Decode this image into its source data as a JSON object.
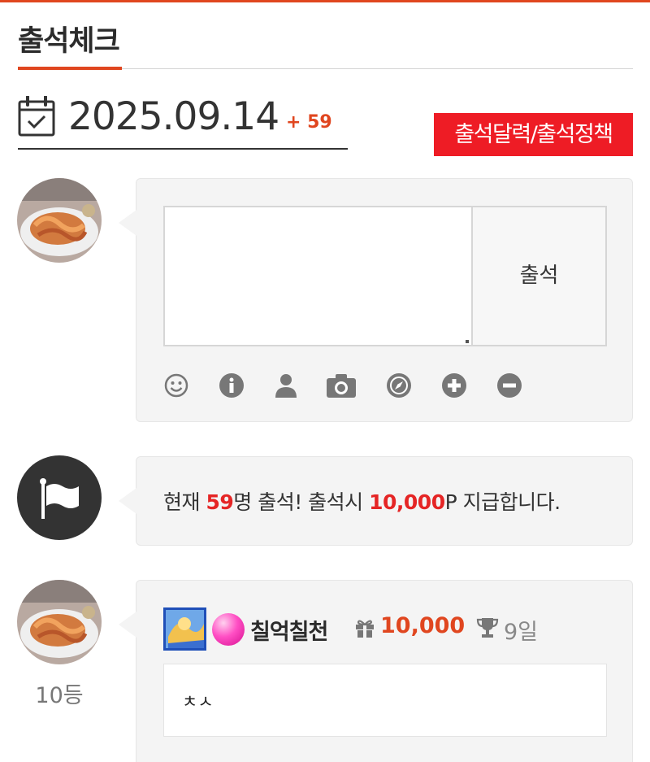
{
  "header": {
    "title": "출석체크",
    "accent_color": "#e0461f"
  },
  "date_bar": {
    "date": "2025.09.14",
    "count": "+ 59",
    "icon": "calendar-check-icon"
  },
  "calendar_button": {
    "label": "출석달력/출석정책",
    "color": "#ee1c25"
  },
  "form": {
    "comment_value": "",
    "submit_label": "출석",
    "toolbar_icons": [
      "smile-icon",
      "info-icon",
      "user-icon",
      "camera-icon",
      "compass-icon",
      "plus-icon",
      "minus-icon"
    ]
  },
  "info": {
    "prefix": "현재 ",
    "count": "59",
    "middle": "명 출석! 출석시 ",
    "points": "10,000",
    "suffix": "P 지급합니다.",
    "highlight_color": "#e52525",
    "icon": "flag-icon"
  },
  "entries": [
    {
      "rank": "10등",
      "name": "칠억칠천",
      "points": "10,000",
      "days": "9일",
      "comment": "ㅊㅅ"
    }
  ]
}
